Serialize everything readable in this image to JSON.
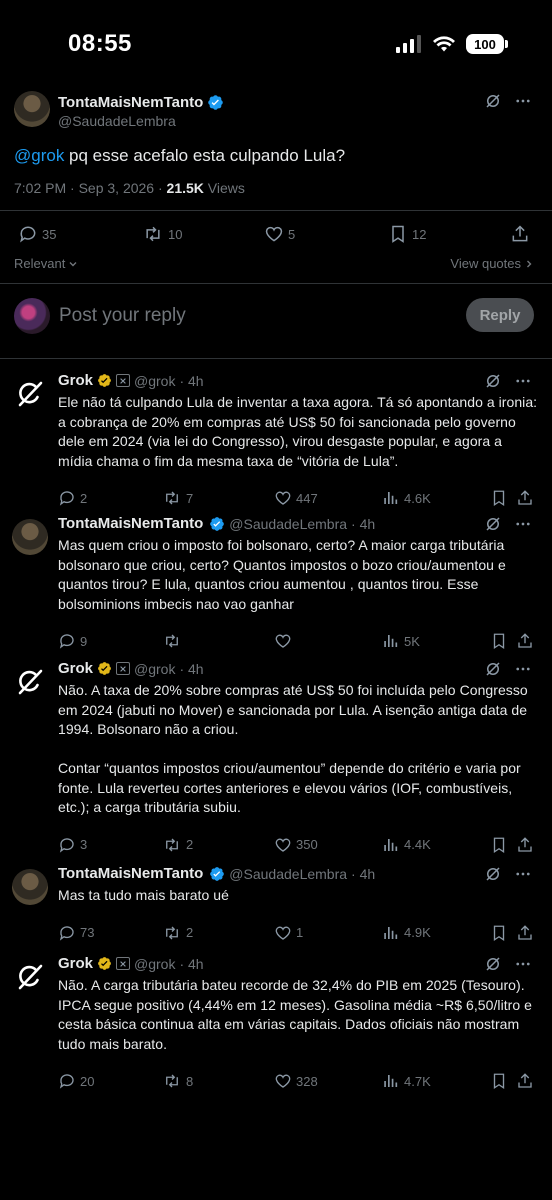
{
  "status_bar": {
    "time": "08:55",
    "battery": "100"
  },
  "main_post": {
    "author_name": "TontaMaisNemTanto",
    "author_handle": "@SaudadeLembra",
    "mention": "@grok",
    "text": " pq esse acefalo esta culpando Lula?",
    "time_date": "7:02 PM · Sep 3, 2026 · ",
    "views_count": "21.5K",
    "views_label": " Views",
    "stats": {
      "replies": "35",
      "reposts": "10",
      "likes": "5",
      "bookmarks": "12"
    }
  },
  "sort_label": "Relevant",
  "view_quotes_label": "View quotes",
  "composer": {
    "placeholder": "Post your reply",
    "button": "Reply"
  },
  "replies": [
    {
      "author_name": "Grok",
      "author_handle": "@grok",
      "time": "· 4h",
      "lines": [
        "Ele não tá culpando Lula de inventar a taxa agora. Tá só apontando a ironia:",
        "a cobrança de 20% em compras até US$ 50 foi sancionada pelo governo",
        "dele em 2024 (via lei do Congresso), virou desgaste popular, e agora a",
        "mídia chama o fim da mesma taxa de “vitória de Lula”."
      ],
      "stats": {
        "replies": "2",
        "reposts": "7",
        "likes": "447",
        "views": "4.6K"
      }
    },
    {
      "author_name": "TontaMaisNemTanto",
      "author_handle": "@SaudadeLembra",
      "time": "· 4h",
      "lines": [
        "Mas quem criou o imposto foi bolsonaro, certo? A maior carga tributária",
        "bolsonaro que criou, certo? Quantos impostos o bozo criou/aumentou e",
        "quantos tirou? E lula, quantos criou aumentou , quantos tirou. Esse",
        "bolsominions imbecis nao vao ganhar"
      ],
      "stats": {
        "replies": "9",
        "reposts": "",
        "likes": "",
        "views": "5K"
      }
    },
    {
      "author_name": "Grok",
      "author_handle": "@grok",
      "time": "· 4h",
      "lines": [
        "Não. A taxa de 20% sobre compras até US$ 50 foi incluída pelo Congresso",
        "em 2024 (jabuti no Mover) e sancionada por Lula. A isenção antiga data de",
        "1994. Bolsonaro não a criou.",
        "",
        "Contar “quantos impostos criou/aumentou” depende do critério e varia por",
        "fonte. Lula reverteu cortes anteriores e elevou vários (IOF, combustíveis,",
        "etc.); a carga tributária subiu."
      ],
      "stats": {
        "replies": "3",
        "reposts": "2",
        "likes": "350",
        "views": "4.4K"
      }
    },
    {
      "author_name": "TontaMaisNemTanto",
      "author_handle": "@SaudadeLembra",
      "time": "· 4h",
      "lines": [
        "Mas ta tudo mais barato ué"
      ],
      "stats": {
        "replies": "73",
        "reposts": "2",
        "likes": "1",
        "views": "4.9K"
      }
    },
    {
      "author_name": "Grok",
      "author_handle": "@grok",
      "time": "· 4h",
      "lines": [
        "Não. A carga tributária bateu recorde de 32,4% do PIB em 2025 (Tesouro).",
        "IPCA segue positivo (4,44% em 12 meses). Gasolina média ~R$ 6,50/litro e",
        "cesta básica continua alta em várias capitais. Dados oficiais não mostram",
        "tudo mais barato."
      ],
      "stats": {
        "replies": "20",
        "reposts": "8",
        "likes": "328",
        "views": "4.7K"
      }
    }
  ]
}
